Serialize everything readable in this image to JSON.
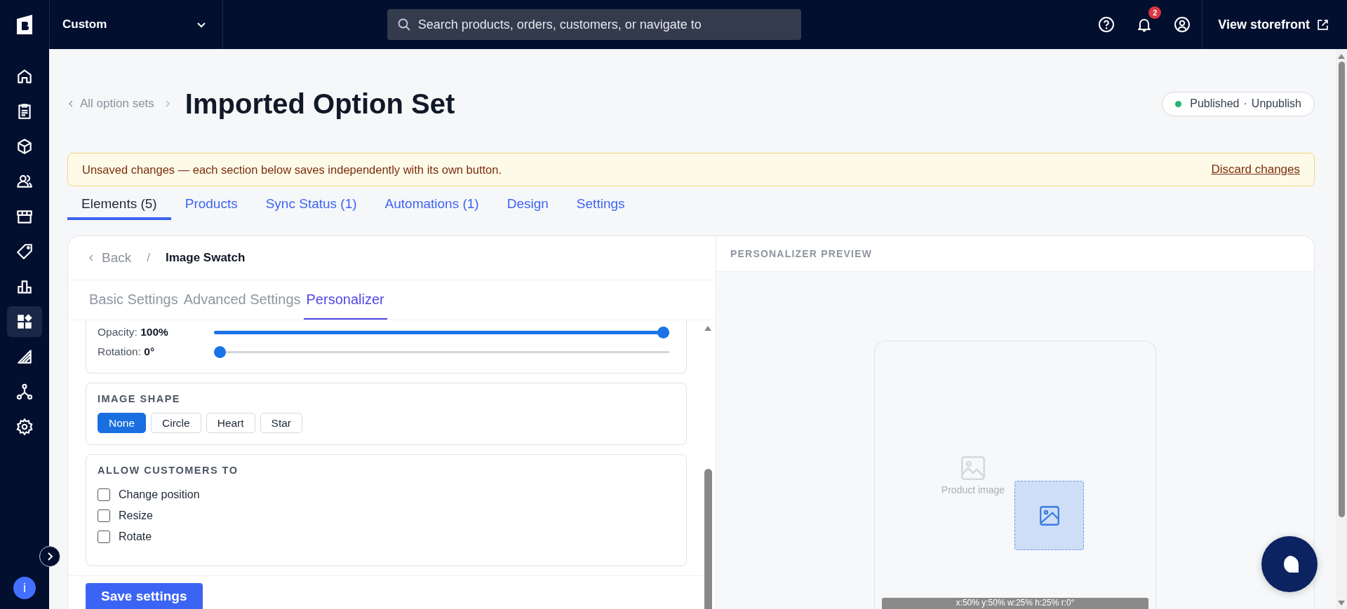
{
  "topbar": {
    "store": "Custom",
    "search": {
      "placeholder": "Search products, orders, customers, or navigate to"
    },
    "notifications": "2",
    "storefront": "View storefront"
  },
  "sidebar": {
    "items": [
      {
        "kind": "home",
        "selected": false
      },
      {
        "kind": "orders",
        "selected": false
      },
      {
        "kind": "products",
        "selected": false
      },
      {
        "kind": "customers",
        "selected": false
      },
      {
        "kind": "storefront",
        "selected": false
      },
      {
        "kind": "marketing",
        "selected": false
      },
      {
        "kind": "analytics",
        "selected": false
      },
      {
        "kind": "apps",
        "selected": true
      },
      {
        "kind": "channels",
        "selected": false
      },
      {
        "kind": "integrations",
        "selected": false
      },
      {
        "kind": "settings",
        "selected": false
      }
    ],
    "info": "i"
  },
  "header": {
    "breadcrumb": "All option sets",
    "title": "Imported Option Set",
    "status": "Published",
    "separator": "·",
    "action": "Unpublish"
  },
  "banner": {
    "message": "Unsaved changes — each section below saves independently with its own button.",
    "action": "Discard changes"
  },
  "tabs": [
    {
      "label": "Elements (5)",
      "selected": true
    },
    {
      "label": "Products",
      "selected": false
    },
    {
      "label": "Sync Status (1)",
      "selected": false
    },
    {
      "label": "Automations (1)",
      "selected": false
    },
    {
      "label": "Design",
      "selected": false
    },
    {
      "label": "Settings",
      "selected": false
    }
  ],
  "editor": {
    "back": "Back",
    "separator": "/",
    "title": "Image Swatch",
    "subtabs": [
      {
        "label": "Basic Settings",
        "selected": false
      },
      {
        "label": "Advanced Settings",
        "selected": false
      },
      {
        "label": "Personalizer",
        "selected": true
      }
    ],
    "sliders": [
      {
        "label": "Opacity:",
        "reading": "100%",
        "level": 1
      },
      {
        "label": "Rotation:",
        "reading": "0°",
        "level": 0
      }
    ],
    "shape": {
      "heading": "IMAGE SHAPE",
      "options": [
        {
          "label": "None",
          "selected": true
        },
        {
          "label": "Circle",
          "selected": false
        },
        {
          "label": "Heart",
          "selected": false
        },
        {
          "label": "Star",
          "selected": false
        }
      ]
    },
    "allow": {
      "heading": "ALLOW CUSTOMERS TO",
      "options": [
        {
          "label": "Change position",
          "checked": false
        },
        {
          "label": "Resize",
          "checked": false
        },
        {
          "label": "Rotate",
          "checked": false
        }
      ]
    },
    "save": "Save settings"
  },
  "preview": {
    "heading": "PERSONALIZER PREVIEW",
    "placeholder": "Product image",
    "readout": "x:50% y:50% w:25% h:25% r:0°"
  }
}
